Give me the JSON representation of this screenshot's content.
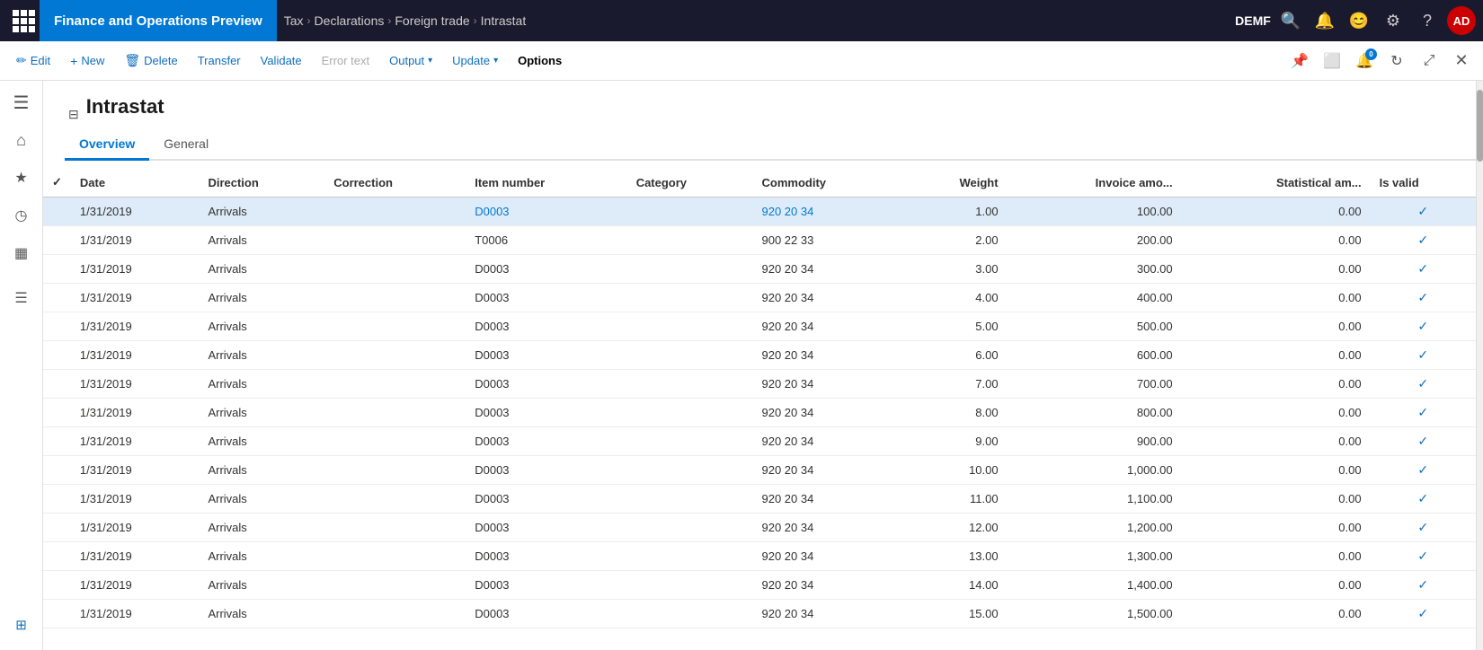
{
  "topNav": {
    "appTitle": "Finance and Operations Preview",
    "env": "DEMF",
    "avatar": "AD",
    "breadcrumbs": [
      "Tax",
      "Declarations",
      "Foreign trade",
      "Intrastat"
    ]
  },
  "actionBar": {
    "edit": "Edit",
    "new": "New",
    "delete": "Delete",
    "transfer": "Transfer",
    "validate": "Validate",
    "errorText": "Error text",
    "output": "Output",
    "update": "Update",
    "options": "Options"
  },
  "sidebar": {
    "items": [
      {
        "icon": "☰",
        "name": "menu"
      },
      {
        "icon": "⌂",
        "name": "home"
      },
      {
        "icon": "★",
        "name": "favorites"
      },
      {
        "icon": "◷",
        "name": "recent"
      },
      {
        "icon": "▦",
        "name": "workspaces"
      },
      {
        "icon": "☰",
        "name": "list"
      }
    ]
  },
  "page": {
    "title": "Intrastat",
    "tabs": [
      "Overview",
      "General"
    ]
  },
  "table": {
    "columns": [
      "Date",
      "Direction",
      "Correction",
      "Item number",
      "Category",
      "Commodity",
      "Weight",
      "Invoice amo...",
      "Statistical am...",
      "Is valid"
    ],
    "rows": [
      {
        "date": "1/31/2019",
        "direction": "Arrivals",
        "correction": "",
        "itemNumber": "D0003",
        "category": "",
        "commodity": "920 20 34",
        "weight": "1.00",
        "invoiceAmt": "100.00",
        "statisticalAmt": "0.00",
        "isValid": true,
        "selected": true
      },
      {
        "date": "1/31/2019",
        "direction": "Arrivals",
        "correction": "",
        "itemNumber": "T0006",
        "category": "",
        "commodity": "900 22 33",
        "weight": "2.00",
        "invoiceAmt": "200.00",
        "statisticalAmt": "0.00",
        "isValid": true,
        "selected": false
      },
      {
        "date": "1/31/2019",
        "direction": "Arrivals",
        "correction": "",
        "itemNumber": "D0003",
        "category": "",
        "commodity": "920 20 34",
        "weight": "3.00",
        "invoiceAmt": "300.00",
        "statisticalAmt": "0.00",
        "isValid": true,
        "selected": false
      },
      {
        "date": "1/31/2019",
        "direction": "Arrivals",
        "correction": "",
        "itemNumber": "D0003",
        "category": "",
        "commodity": "920 20 34",
        "weight": "4.00",
        "invoiceAmt": "400.00",
        "statisticalAmt": "0.00",
        "isValid": true,
        "selected": false
      },
      {
        "date": "1/31/2019",
        "direction": "Arrivals",
        "correction": "",
        "itemNumber": "D0003",
        "category": "",
        "commodity": "920 20 34",
        "weight": "5.00",
        "invoiceAmt": "500.00",
        "statisticalAmt": "0.00",
        "isValid": true,
        "selected": false
      },
      {
        "date": "1/31/2019",
        "direction": "Arrivals",
        "correction": "",
        "itemNumber": "D0003",
        "category": "",
        "commodity": "920 20 34",
        "weight": "6.00",
        "invoiceAmt": "600.00",
        "statisticalAmt": "0.00",
        "isValid": true,
        "selected": false
      },
      {
        "date": "1/31/2019",
        "direction": "Arrivals",
        "correction": "",
        "itemNumber": "D0003",
        "category": "",
        "commodity": "920 20 34",
        "weight": "7.00",
        "invoiceAmt": "700.00",
        "statisticalAmt": "0.00",
        "isValid": true,
        "selected": false
      },
      {
        "date": "1/31/2019",
        "direction": "Arrivals",
        "correction": "",
        "itemNumber": "D0003",
        "category": "",
        "commodity": "920 20 34",
        "weight": "8.00",
        "invoiceAmt": "800.00",
        "statisticalAmt": "0.00",
        "isValid": true,
        "selected": false
      },
      {
        "date": "1/31/2019",
        "direction": "Arrivals",
        "correction": "",
        "itemNumber": "D0003",
        "category": "",
        "commodity": "920 20 34",
        "weight": "9.00",
        "invoiceAmt": "900.00",
        "statisticalAmt": "0.00",
        "isValid": true,
        "selected": false
      },
      {
        "date": "1/31/2019",
        "direction": "Arrivals",
        "correction": "",
        "itemNumber": "D0003",
        "category": "",
        "commodity": "920 20 34",
        "weight": "10.00",
        "invoiceAmt": "1,000.00",
        "statisticalAmt": "0.00",
        "isValid": true,
        "selected": false
      },
      {
        "date": "1/31/2019",
        "direction": "Arrivals",
        "correction": "",
        "itemNumber": "D0003",
        "category": "",
        "commodity": "920 20 34",
        "weight": "11.00",
        "invoiceAmt": "1,100.00",
        "statisticalAmt": "0.00",
        "isValid": true,
        "selected": false
      },
      {
        "date": "1/31/2019",
        "direction": "Arrivals",
        "correction": "",
        "itemNumber": "D0003",
        "category": "",
        "commodity": "920 20 34",
        "weight": "12.00",
        "invoiceAmt": "1,200.00",
        "statisticalAmt": "0.00",
        "isValid": true,
        "selected": false
      },
      {
        "date": "1/31/2019",
        "direction": "Arrivals",
        "correction": "",
        "itemNumber": "D0003",
        "category": "",
        "commodity": "920 20 34",
        "weight": "13.00",
        "invoiceAmt": "1,300.00",
        "statisticalAmt": "0.00",
        "isValid": true,
        "selected": false
      },
      {
        "date": "1/31/2019",
        "direction": "Arrivals",
        "correction": "",
        "itemNumber": "D0003",
        "category": "",
        "commodity": "920 20 34",
        "weight": "14.00",
        "invoiceAmt": "1,400.00",
        "statisticalAmt": "0.00",
        "isValid": true,
        "selected": false
      },
      {
        "date": "1/31/2019",
        "direction": "Arrivals",
        "correction": "",
        "itemNumber": "D0003",
        "category": "",
        "commodity": "920 20 34",
        "weight": "15.00",
        "invoiceAmt": "1,500.00",
        "statisticalAmt": "0.00",
        "isValid": true,
        "selected": false
      }
    ]
  }
}
